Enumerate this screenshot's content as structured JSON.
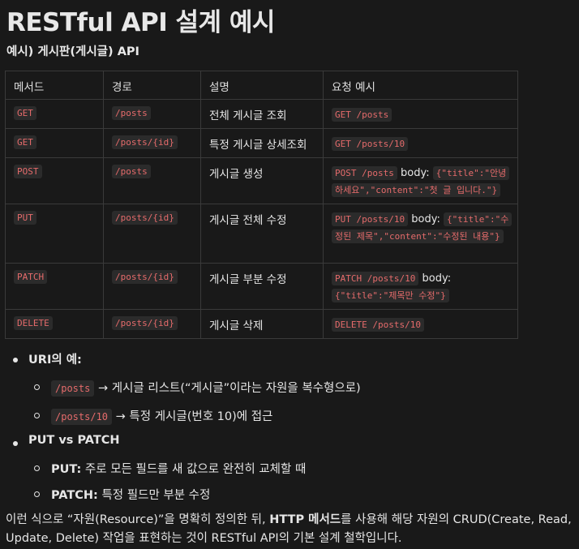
{
  "title": "RESTful API 설계 예시",
  "subtitle": "예시) 게시판(게시글) API",
  "table": {
    "headers": [
      "메서드",
      "경로",
      "설명",
      "요청 예시"
    ],
    "rows": [
      {
        "method": "GET",
        "path": "/posts",
        "desc": "전체 게시글 조회",
        "req": "GET /posts"
      },
      {
        "method": "GET",
        "path": "/posts/{id}",
        "desc": "특정 게시글 상세조회",
        "req": "GET /posts/10"
      },
      {
        "method": "POST",
        "path": "/posts",
        "desc": "게시글 생성",
        "req": "POST /posts",
        "body_label": "body:",
        "body": "{\"title\":\"안녕하세요\",\"content\":\"첫 글 입니다.\"}"
      },
      {
        "method": "PUT",
        "path": "/posts/{id}",
        "desc": "게시글 전체 수정",
        "req": "PUT /posts/10",
        "body_label": "body:",
        "body": "{\"title\":\"수정된 제목\",\"content\":\"수정된 내용\"}"
      },
      {
        "method": "PATCH",
        "path": "/posts/{id}",
        "desc": "게시글 부분 수정",
        "req": "PATCH /posts/10",
        "body_label": "body:",
        "body": "{\"title\":\"제목만 수정\"}"
      },
      {
        "method": "DELETE",
        "path": "/posts/{id}",
        "desc": "게시글 삭제",
        "req": "DELETE /posts/10"
      }
    ]
  },
  "bullets": {
    "uri_title": "URI의 예:",
    "uri_1_code": "/posts",
    "uri_1_text": "→ 게시글 리스트(“게시글”이라는 자원을 복수형으로)",
    "uri_2_code": "/posts/10",
    "uri_2_text": "→ 특정 게시글(번호 10)에 접근",
    "put_patch_title": "PUT vs PATCH",
    "put_label": "PUT:",
    "put_text": "주로 모든 필드를 새 값으로 완전히 교체할 때",
    "patch_label": "PATCH:",
    "patch_text": "특정 필드만 부분 수정"
  },
  "paragraph": {
    "part1": "이런 식으로 “자원(Resource)”을 명확히 정의한 뒤, ",
    "bold": "HTTP 메서드",
    "part2": "를 사용해 해당 자원의 CRUD(Create, Read, Update, Delete) 작업을 표현하는 것이 RESTful API의 기본 설계 철학입니다."
  },
  "colors": {
    "background": "#191919",
    "text": "#e6e6e6",
    "code": "#e56b6b",
    "code_bg": "#2b2b2b",
    "border": "#3a3a3a"
  }
}
